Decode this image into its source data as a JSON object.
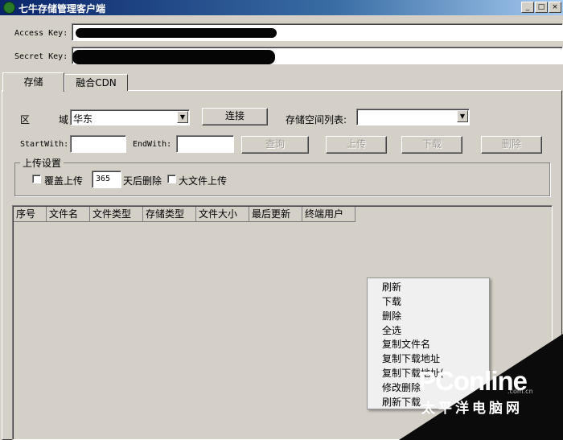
{
  "window": {
    "title": "七牛存储管理客户端",
    "controls": {
      "minimize": "_",
      "maximize": "□",
      "close": "×"
    }
  },
  "keys": {
    "access_label": "Access Key:",
    "secret_label": "Secret Key:"
  },
  "tabs": [
    "存储",
    "融合CDN"
  ],
  "region": {
    "label_a": "区",
    "label_b": "域",
    "value": "华东",
    "connect_button": "连接",
    "bucket_label": "存储空间列表:",
    "bucket_value": ""
  },
  "filter": {
    "startwith_label": "StartWith:",
    "endwith_label": "EndWith:",
    "query_button": "查询",
    "upload_button": "上传",
    "download_button": "下载",
    "delete_button": "删除"
  },
  "upload_settings": {
    "legend": "上传设置",
    "overwrite_label": "覆盖上传",
    "days_value": "365",
    "days_suffix": "天后删除",
    "large_file_label": "大文件上传"
  },
  "table": {
    "columns": [
      "序号",
      "文件名",
      "文件类型",
      "存储类型",
      "文件大小",
      "最后更新",
      "终端用户"
    ]
  },
  "context_menu": {
    "items": [
      "刷新",
      "下载",
      "删除",
      "全选",
      "复制文件名",
      "复制下载地址",
      "复制下载地址(",
      "修改删除",
      "刷新下载"
    ]
  },
  "watermark": {
    "brand": "PConline",
    "domain": ".com.cn",
    "cn": "太平洋电脑网"
  }
}
